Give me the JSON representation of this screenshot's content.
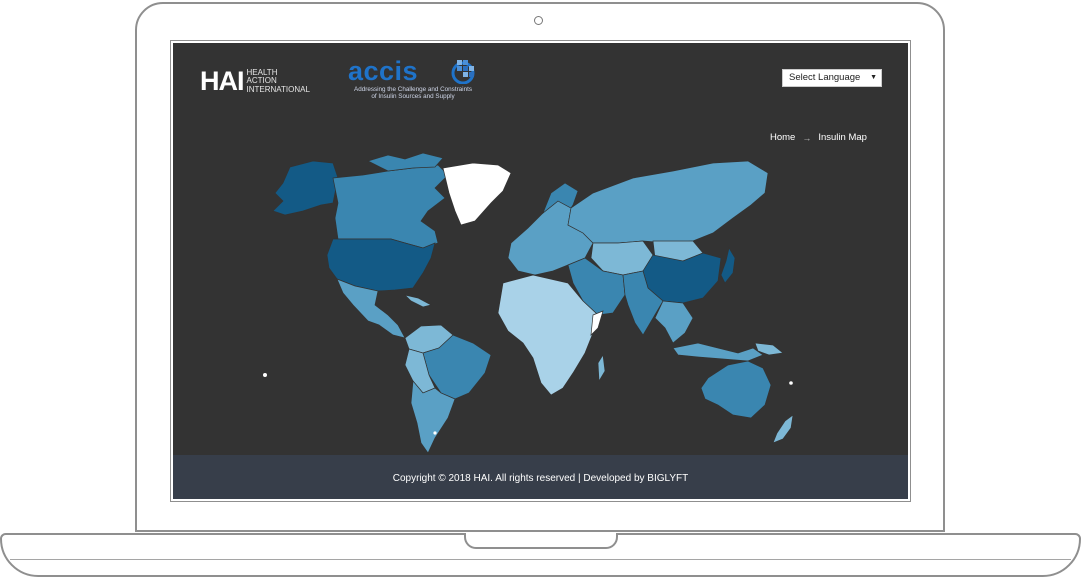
{
  "header": {
    "hai_logo": {
      "mark": "HAI",
      "line1": "HEALTH",
      "line2": "ACTION",
      "line3": "INTERNATIONAL"
    },
    "accis_logo": {
      "word": "accis",
      "tagline1": "Addressing the Challenge and Constraints",
      "tagline2": "of Insulin Sources and Supply"
    },
    "language_select": {
      "value": "Select Language"
    }
  },
  "breadcrumb": {
    "home": "Home",
    "separator": "→",
    "current": "Insulin Map"
  },
  "map": {
    "legend_colors": {
      "dark": "#135a86",
      "mid": "#3a86b0",
      "light": "#5aa0c5",
      "lighter": "#7db8d6",
      "lightest": "#a9d2e8",
      "none": "#ffffff"
    }
  },
  "footer": {
    "copyright": "Copyright © 2018 HAI. All rights reserved | Developed by BIGLYFT"
  },
  "colors": {
    "background": "#333333",
    "footer": "#373e4a",
    "accent": "#1f73c9"
  }
}
